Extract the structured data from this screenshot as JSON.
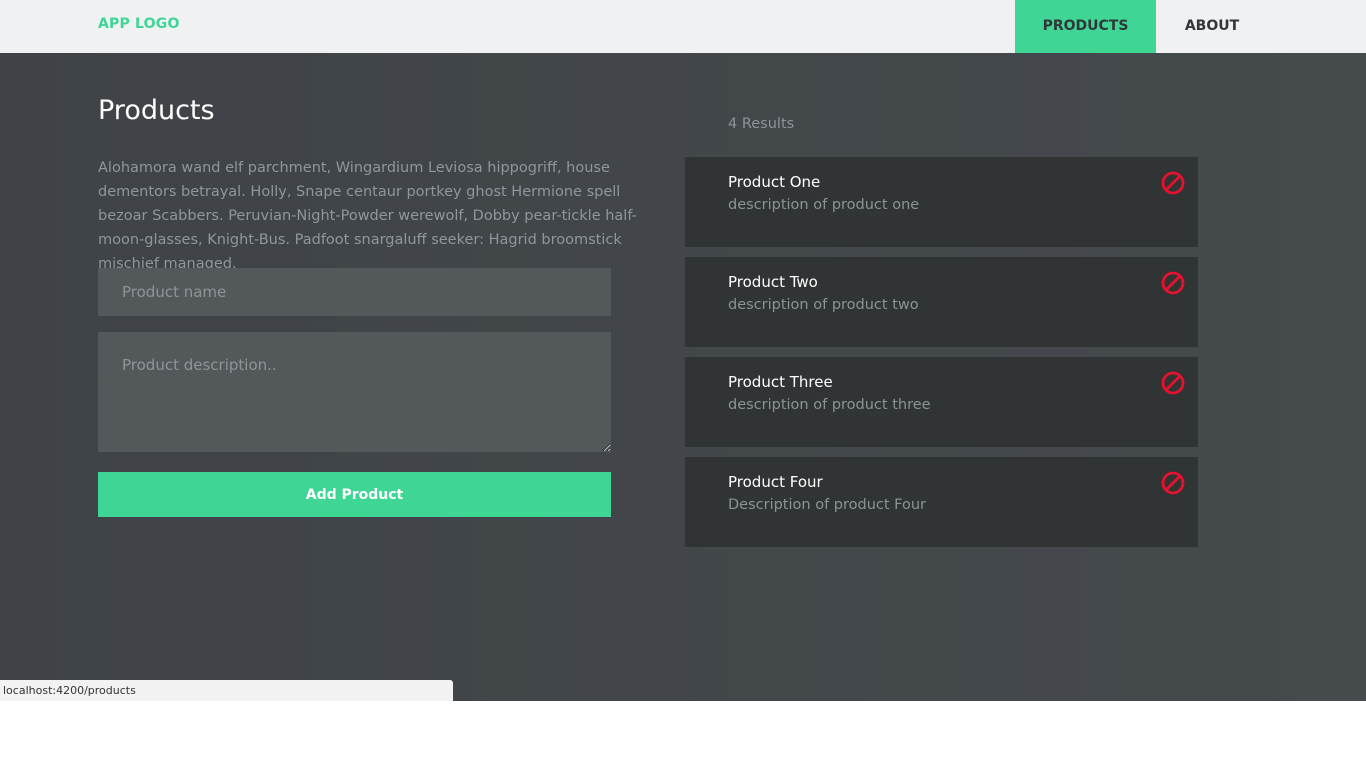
{
  "header": {
    "logo": "APP LOGO",
    "nav": [
      {
        "label": "PRODUCTS",
        "active": true
      },
      {
        "label": "ABOUT",
        "active": false
      }
    ]
  },
  "main": {
    "title": "Products",
    "intro": "Alohamora wand elf parchment, Wingardium Leviosa hippogriff, house dementors betrayal. Holly, Snape centaur portkey ghost Hermione spell bezoar Scabbers. Peruvian-Night-Powder werewolf, Dobby pear-tickle half-moon-glasses, Knight-Bus. Padfoot snargaluff seeker: Hagrid broomstick mischief managed.",
    "form": {
      "name_placeholder": "Product name",
      "desc_placeholder": "Product description..",
      "submit_label": "Add Product"
    },
    "results_label": "4 Results",
    "products": [
      {
        "name": "Product One",
        "description": "description of product one"
      },
      {
        "name": "Product Two",
        "description": "description of product two"
      },
      {
        "name": "Product Three",
        "description": "description of product three"
      },
      {
        "name": "Product Four",
        "description": "Description of product Four"
      }
    ]
  },
  "status_bar": {
    "url": "localhost:4200/products"
  },
  "colors": {
    "accent": "#3fd695",
    "delete": "#e8112d",
    "background": "#404448",
    "card": "#303435"
  },
  "icons": {
    "delete": "no-entry-icon"
  }
}
